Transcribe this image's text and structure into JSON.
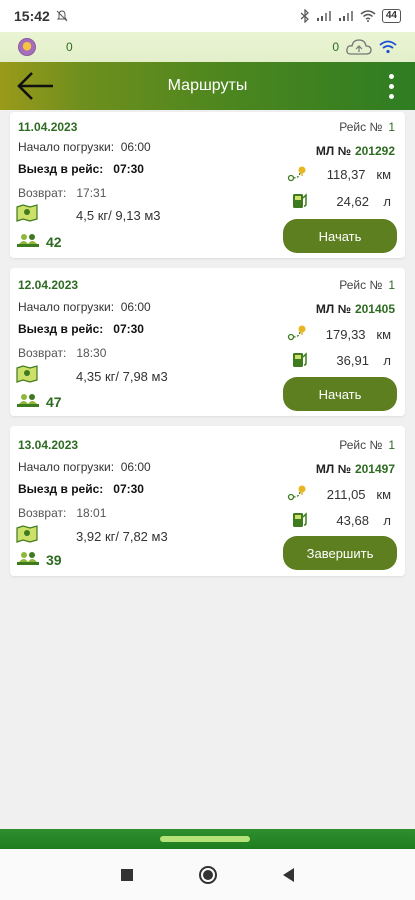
{
  "status_bar": {
    "time": "15:42",
    "battery": "44"
  },
  "info_bar": {
    "left_value": "0",
    "right_value": "0"
  },
  "toolbar": {
    "title": "Маршруты"
  },
  "labels": {
    "start_loading": "Начало погрузки:",
    "departure": "Выезд в рейс:",
    "return": "Возврат:",
    "trip": "Рейс №",
    "ml": "МЛ №",
    "km_unit": "км",
    "fuel_unit": "л",
    "weight_sep": "кг/",
    "volume_unit": "м3"
  },
  "routes": [
    {
      "date": "11.04.2023",
      "start_loading": "06:00",
      "departure": "07:30",
      "return": "17:31",
      "weight": "4,5",
      "volume": "9,13",
      "count": "42",
      "trip": "1",
      "ml": "201292",
      "km": "118,37",
      "fuel": "24,62",
      "action": "Начать"
    },
    {
      "date": "12.04.2023",
      "start_loading": "06:00",
      "departure": "07:30",
      "return": "18:30",
      "weight": "4,35",
      "volume": "7,98",
      "count": "47",
      "trip": "1",
      "ml": "201405",
      "km": "179,33",
      "fuel": "36,91",
      "action": "Начать"
    },
    {
      "date": "13.04.2023",
      "start_loading": "06:00",
      "departure": "07:30",
      "return": "18:01",
      "weight": "3,92",
      "volume": "7,82",
      "count": "39",
      "trip": "1",
      "ml": "201497",
      "km": "211,05",
      "fuel": "43,68",
      "action": "Завершить"
    }
  ],
  "colors": {
    "accent": "#2e6b22",
    "button": "#5d7f20",
    "toolbar_start": "#9a9a1a",
    "toolbar_end": "#2f7d22"
  }
}
